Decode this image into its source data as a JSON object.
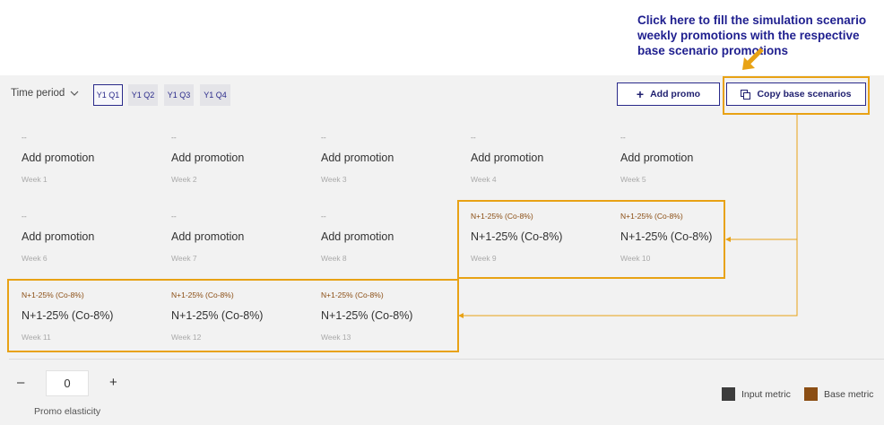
{
  "callout": {
    "text": "Click here to fill the simulation scenario weekly promotions with the respective base scenario promotions"
  },
  "toolbar": {
    "time_period_label": "Time period",
    "quarters": [
      "Y1 Q1",
      "Y1 Q2",
      "Y1 Q3",
      "Y1 Q4"
    ],
    "selected_quarter": "Y1 Q1",
    "add_promo_label": "Add promo",
    "copy_base_label": "Copy base scenarios"
  },
  "weeks": [
    {
      "top": "--",
      "main": "Add promotion",
      "week": "Week 1"
    },
    {
      "top": "--",
      "main": "Add promotion",
      "week": "Week 2"
    },
    {
      "top": "--",
      "main": "Add promotion",
      "week": "Week 3"
    },
    {
      "top": "--",
      "main": "Add promotion",
      "week": "Week 4"
    },
    {
      "top": "--",
      "main": "Add promotion",
      "week": "Week 5"
    },
    {
      "top": "--",
      "main": "Add promotion",
      "week": "Week 6"
    },
    {
      "top": "--",
      "main": "Add promotion",
      "week": "Week 7"
    },
    {
      "top": "--",
      "main": "Add promotion",
      "week": "Week 8"
    },
    {
      "top": "N+1-25% (Co-8%)",
      "main": "N+1-25% (Co-8%)",
      "week": "Week 9"
    },
    {
      "top": "N+1-25% (Co-8%)",
      "main": "N+1-25% (Co-8%)",
      "week": "Week 10"
    },
    {
      "top": "N+1-25% (Co-8%)",
      "main": "N+1-25% (Co-8%)",
      "week": "Week 11"
    },
    {
      "top": "N+1-25% (Co-8%)",
      "main": "N+1-25% (Co-8%)",
      "week": "Week 12"
    },
    {
      "top": "N+1-25% (Co-8%)",
      "main": "N+1-25% (Co-8%)",
      "week": "Week 13"
    }
  ],
  "elasticity": {
    "minus": "–",
    "plus": "+",
    "value": "0",
    "label": "Promo elasticity"
  },
  "legend": {
    "input_label": "Input metric",
    "base_label": "Base metric"
  },
  "colors": {
    "input_metric": "#3d3d3d",
    "base_metric": "#8b4e14",
    "highlight": "#e8a215",
    "accent": "#2a2a8a"
  }
}
